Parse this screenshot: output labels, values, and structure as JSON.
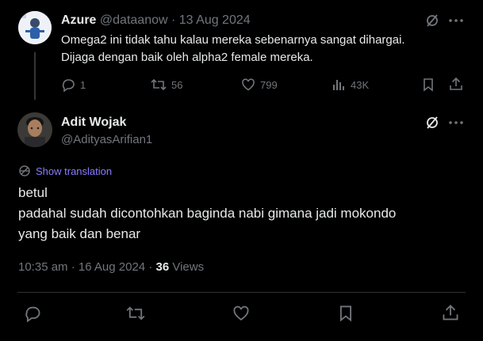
{
  "parent": {
    "name": "Azure",
    "handle": "@dataanow",
    "sep": "·",
    "date": "13 Aug 2024",
    "text_line1": "Omega2 ini tidak tahu kalau mereka sebenarnya sangat dihargai.",
    "text_line2": "Dijaga dengan baik oleh alpha2 female mereka.",
    "replies": "1",
    "reposts": "56",
    "likes": "799",
    "views": "43K"
  },
  "main": {
    "name": "Adit Wojak",
    "handle": "@AdityasArifian1",
    "show_translation": "Show translation",
    "text_line1": "betul",
    "text_line2": "padahal sudah dicontohkan baginda nabi gimana jadi mokondo",
    "text_line3": "yang baik dan benar",
    "time": "10:35 am",
    "sep": "·",
    "date": "16 Aug 2024",
    "sep2": "·",
    "views_count": "36",
    "views_label": "Views"
  },
  "icons": {
    "grok": "grok-slash-icon",
    "more": "more-dots-icon",
    "reply": "reply-icon",
    "repost": "repost-icon",
    "like": "heart-icon",
    "views": "views-bar-icon",
    "bookmark": "bookmark-icon",
    "share": "share-icon",
    "translate": "translate-globe-icon"
  },
  "colors": {
    "background": "#000000",
    "text": "#e7e9ea",
    "muted": "#71767b",
    "link": "#8b7cff",
    "divider": "#2f3336"
  }
}
